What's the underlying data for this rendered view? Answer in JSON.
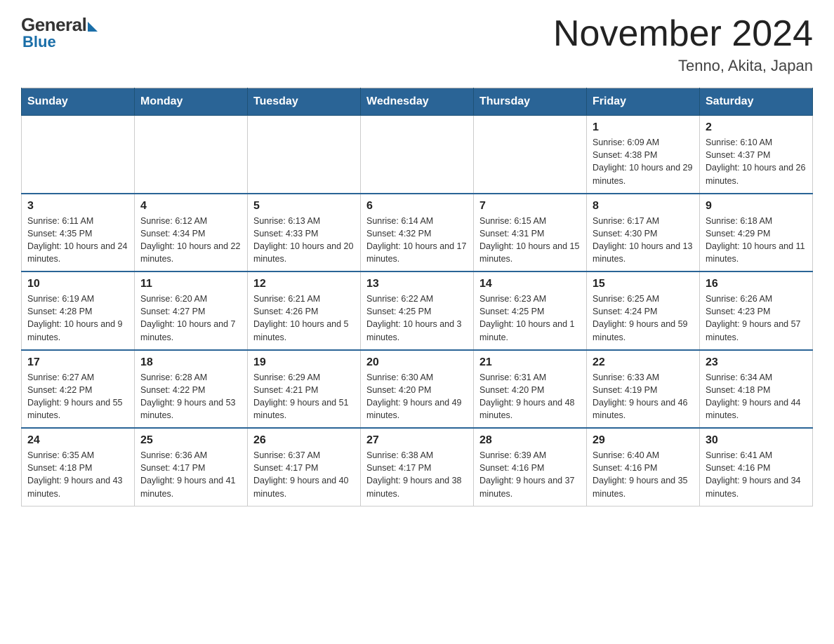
{
  "header": {
    "logo_general": "General",
    "logo_blue": "Blue",
    "month_title": "November 2024",
    "location": "Tenno, Akita, Japan"
  },
  "weekdays": [
    "Sunday",
    "Monday",
    "Tuesday",
    "Wednesday",
    "Thursday",
    "Friday",
    "Saturday"
  ],
  "weeks": [
    [
      {
        "day": "",
        "info": ""
      },
      {
        "day": "",
        "info": ""
      },
      {
        "day": "",
        "info": ""
      },
      {
        "day": "",
        "info": ""
      },
      {
        "day": "",
        "info": ""
      },
      {
        "day": "1",
        "info": "Sunrise: 6:09 AM\nSunset: 4:38 PM\nDaylight: 10 hours and 29 minutes."
      },
      {
        "day": "2",
        "info": "Sunrise: 6:10 AM\nSunset: 4:37 PM\nDaylight: 10 hours and 26 minutes."
      }
    ],
    [
      {
        "day": "3",
        "info": "Sunrise: 6:11 AM\nSunset: 4:35 PM\nDaylight: 10 hours and 24 minutes."
      },
      {
        "day": "4",
        "info": "Sunrise: 6:12 AM\nSunset: 4:34 PM\nDaylight: 10 hours and 22 minutes."
      },
      {
        "day": "5",
        "info": "Sunrise: 6:13 AM\nSunset: 4:33 PM\nDaylight: 10 hours and 20 minutes."
      },
      {
        "day": "6",
        "info": "Sunrise: 6:14 AM\nSunset: 4:32 PM\nDaylight: 10 hours and 17 minutes."
      },
      {
        "day": "7",
        "info": "Sunrise: 6:15 AM\nSunset: 4:31 PM\nDaylight: 10 hours and 15 minutes."
      },
      {
        "day": "8",
        "info": "Sunrise: 6:17 AM\nSunset: 4:30 PM\nDaylight: 10 hours and 13 minutes."
      },
      {
        "day": "9",
        "info": "Sunrise: 6:18 AM\nSunset: 4:29 PM\nDaylight: 10 hours and 11 minutes."
      }
    ],
    [
      {
        "day": "10",
        "info": "Sunrise: 6:19 AM\nSunset: 4:28 PM\nDaylight: 10 hours and 9 minutes."
      },
      {
        "day": "11",
        "info": "Sunrise: 6:20 AM\nSunset: 4:27 PM\nDaylight: 10 hours and 7 minutes."
      },
      {
        "day": "12",
        "info": "Sunrise: 6:21 AM\nSunset: 4:26 PM\nDaylight: 10 hours and 5 minutes."
      },
      {
        "day": "13",
        "info": "Sunrise: 6:22 AM\nSunset: 4:25 PM\nDaylight: 10 hours and 3 minutes."
      },
      {
        "day": "14",
        "info": "Sunrise: 6:23 AM\nSunset: 4:25 PM\nDaylight: 10 hours and 1 minute."
      },
      {
        "day": "15",
        "info": "Sunrise: 6:25 AM\nSunset: 4:24 PM\nDaylight: 9 hours and 59 minutes."
      },
      {
        "day": "16",
        "info": "Sunrise: 6:26 AM\nSunset: 4:23 PM\nDaylight: 9 hours and 57 minutes."
      }
    ],
    [
      {
        "day": "17",
        "info": "Sunrise: 6:27 AM\nSunset: 4:22 PM\nDaylight: 9 hours and 55 minutes."
      },
      {
        "day": "18",
        "info": "Sunrise: 6:28 AM\nSunset: 4:22 PM\nDaylight: 9 hours and 53 minutes."
      },
      {
        "day": "19",
        "info": "Sunrise: 6:29 AM\nSunset: 4:21 PM\nDaylight: 9 hours and 51 minutes."
      },
      {
        "day": "20",
        "info": "Sunrise: 6:30 AM\nSunset: 4:20 PM\nDaylight: 9 hours and 49 minutes."
      },
      {
        "day": "21",
        "info": "Sunrise: 6:31 AM\nSunset: 4:20 PM\nDaylight: 9 hours and 48 minutes."
      },
      {
        "day": "22",
        "info": "Sunrise: 6:33 AM\nSunset: 4:19 PM\nDaylight: 9 hours and 46 minutes."
      },
      {
        "day": "23",
        "info": "Sunrise: 6:34 AM\nSunset: 4:18 PM\nDaylight: 9 hours and 44 minutes."
      }
    ],
    [
      {
        "day": "24",
        "info": "Sunrise: 6:35 AM\nSunset: 4:18 PM\nDaylight: 9 hours and 43 minutes."
      },
      {
        "day": "25",
        "info": "Sunrise: 6:36 AM\nSunset: 4:17 PM\nDaylight: 9 hours and 41 minutes."
      },
      {
        "day": "26",
        "info": "Sunrise: 6:37 AM\nSunset: 4:17 PM\nDaylight: 9 hours and 40 minutes."
      },
      {
        "day": "27",
        "info": "Sunrise: 6:38 AM\nSunset: 4:17 PM\nDaylight: 9 hours and 38 minutes."
      },
      {
        "day": "28",
        "info": "Sunrise: 6:39 AM\nSunset: 4:16 PM\nDaylight: 9 hours and 37 minutes."
      },
      {
        "day": "29",
        "info": "Sunrise: 6:40 AM\nSunset: 4:16 PM\nDaylight: 9 hours and 35 minutes."
      },
      {
        "day": "30",
        "info": "Sunrise: 6:41 AM\nSunset: 4:16 PM\nDaylight: 9 hours and 34 minutes."
      }
    ]
  ]
}
